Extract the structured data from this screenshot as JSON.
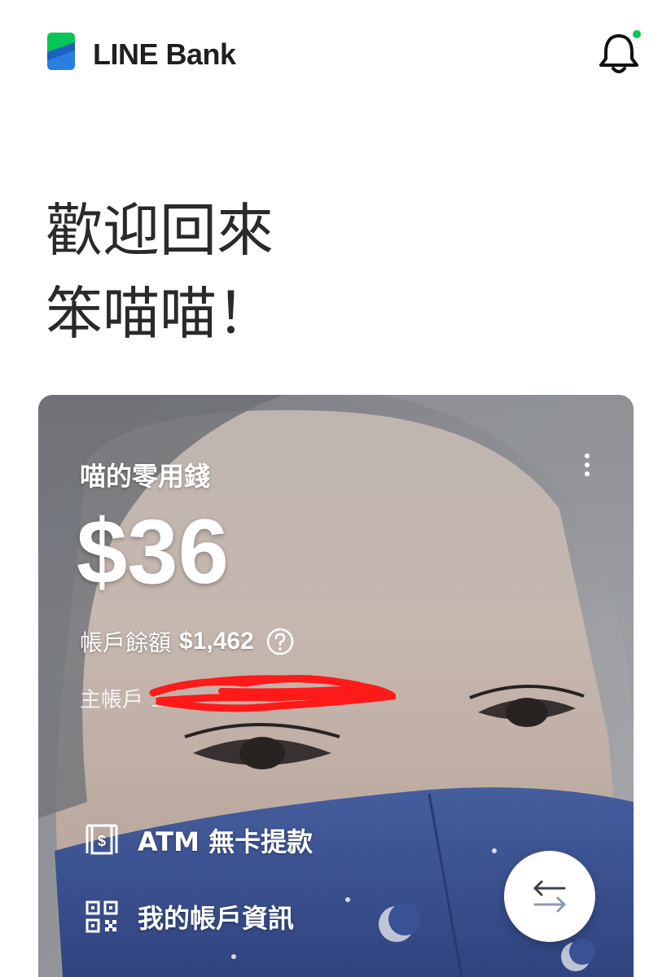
{
  "header": {
    "brand": "LINE Bank",
    "notification_dot_color": "#06c755"
  },
  "greeting": {
    "line1": "歡迎回來",
    "line2": "笨喵喵！"
  },
  "card": {
    "account_name": "喵的零用錢",
    "amount": "$36",
    "balance_label": "帳戶餘額",
    "balance_value": "$1,462",
    "main_account_label": "主帳戶 1",
    "actions": [
      {
        "label": "ATM 無卡提款",
        "icon": "atm-cash-icon"
      },
      {
        "label": "我的帳戶資訊",
        "icon": "qr-code-icon"
      }
    ],
    "transfer_icon": "transfer-arrows-icon"
  }
}
